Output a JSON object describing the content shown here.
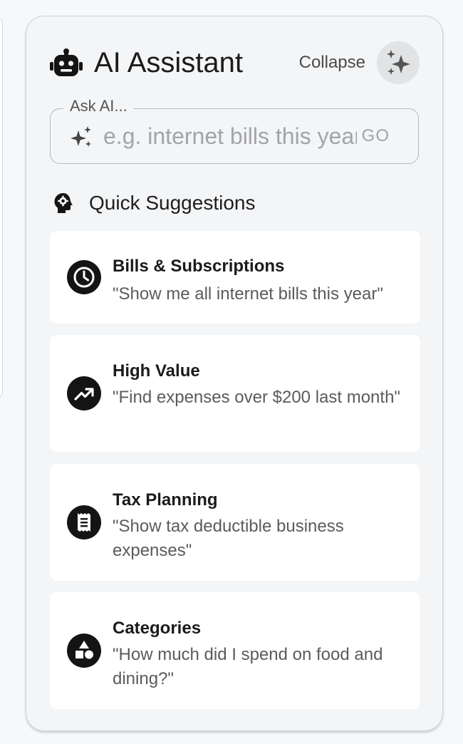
{
  "assistant": {
    "title": "AI Assistant",
    "collapse_label": "Collapse",
    "ask_label": "Ask AI...",
    "ask_placeholder": "e.g. internet bills this year",
    "go_label": "GO"
  },
  "suggestions": {
    "heading": "Quick Suggestions",
    "items": [
      {
        "title": "Bills & Subscriptions",
        "text": "\"Show me all internet bills this year\"",
        "icon": "clock-icon"
      },
      {
        "title": "High Value",
        "text": "\"Find expenses over $200 last month\"",
        "icon": "trending-up-icon"
      },
      {
        "title": "Tax Planning",
        "text": "\"Show tax deductible business expenses\"",
        "icon": "receipt-icon"
      },
      {
        "title": "Categories",
        "text": "\"How much did I spend on food and dining?\"",
        "icon": "category-icon"
      }
    ]
  },
  "colors": {
    "panel_bg": "#f4f5f7",
    "card_bg": "#ffffff",
    "icon_bg": "#141414",
    "text_primary": "#1b1b1b",
    "text_secondary": "#5b5b5b"
  }
}
